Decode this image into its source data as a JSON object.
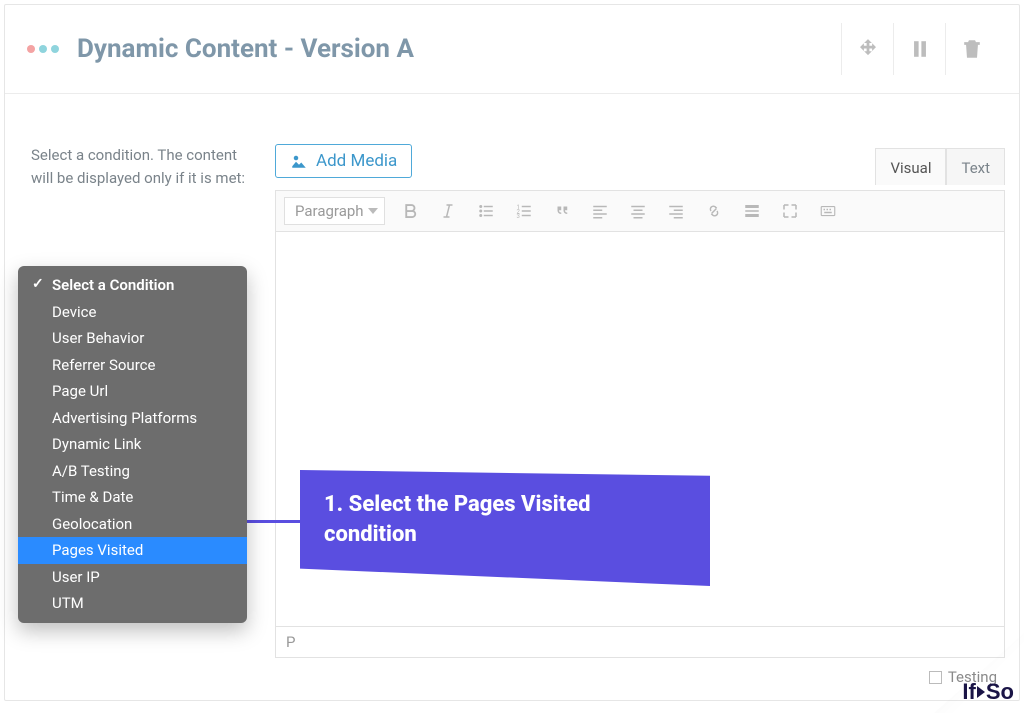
{
  "header": {
    "title": "Dynamic Content - Version A"
  },
  "sidebar": {
    "help": "Select a condition. The content will be displayed only if it is met:"
  },
  "media_button": "Add Media",
  "tabs": {
    "visual": "Visual",
    "text": "Text"
  },
  "toolbar": {
    "paragraph": "Paragraph"
  },
  "dropdown": {
    "placeholder": "Select a Condition",
    "options": [
      "Device",
      "User Behavior",
      "Referrer Source",
      "Page Url",
      "Advertising Platforms",
      "Dynamic Link",
      "A/B Testing",
      "Time & Date",
      "Geolocation",
      "Pages Visited",
      "User IP",
      "UTM"
    ],
    "selected": "Pages Visited"
  },
  "callout": "1. Select the Pages Visited condition",
  "status": "P",
  "footer": {
    "testing": "Testing"
  },
  "logo": {
    "if": "If",
    "so": "So"
  }
}
